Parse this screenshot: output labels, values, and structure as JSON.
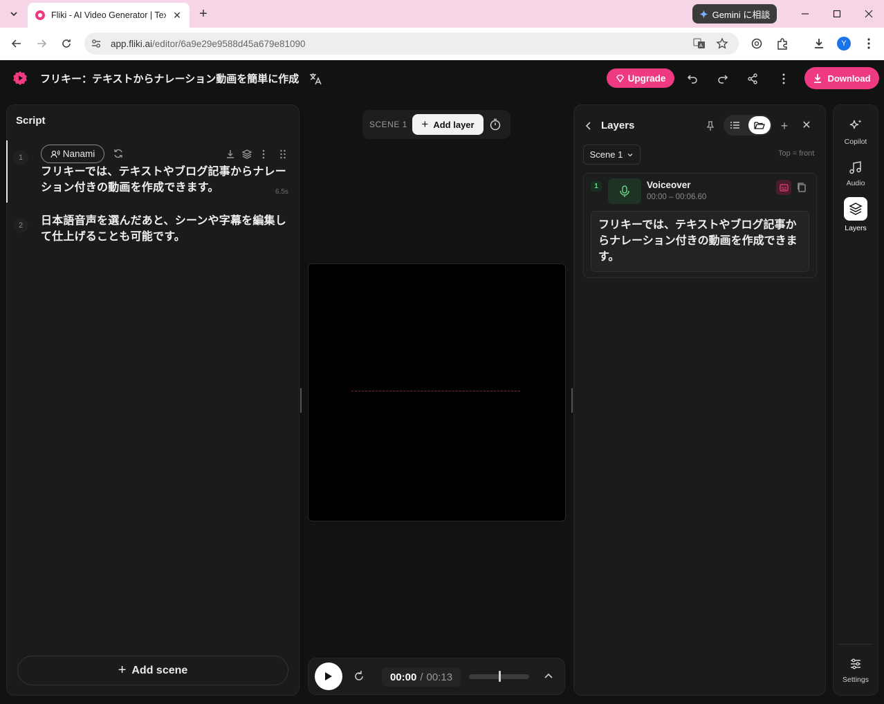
{
  "browser": {
    "tab_title": "Fliki - AI Video Generator | Text",
    "url_host": "app.fliki.ai",
    "url_path": "/editor/6a9e29e9588d45a679e81090",
    "gemini_label": "Gemini に相談",
    "profile_initial": "Y"
  },
  "header": {
    "project_title": "フリキー：テキストからナレーション動画を簡単に作成",
    "upgrade_label": "Upgrade",
    "download_label": "Download",
    "accent": "#ee3a80"
  },
  "script": {
    "title": "Script",
    "voice_name": "Nanami",
    "scenes": [
      {
        "num": "1",
        "text": "フリキーでは、テキストやブログ記事からナレーション付きの動画を作成できます。",
        "duration": "6.5s"
      },
      {
        "num": "2",
        "text": "日本語音声を選んだあと、シーンや字幕を編集して仕上げることも可能です。"
      }
    ],
    "add_scene_label": "Add scene"
  },
  "center": {
    "scene_label": "SCENE 1",
    "add_layer_label": "Add layer",
    "time_current": "00:00",
    "time_separator": "/",
    "time_total": "00:13",
    "volume_level": 0.5
  },
  "layers": {
    "title": "Layers",
    "scene_select": "Scene 1",
    "order_hint": "Top = front",
    "items": [
      {
        "num": "1",
        "name": "Voiceover",
        "time": "00:00 – 00:06.60",
        "text": "フリキーでは、テキストやブログ記事からナレーション付きの動画を作成できます。"
      }
    ]
  },
  "rail": {
    "items": [
      {
        "label": "Copilot",
        "icon": "sparkle-icon"
      },
      {
        "label": "Audio",
        "icon": "music-note-icon"
      },
      {
        "label": "Layers",
        "icon": "layers-icon",
        "active": true
      },
      {
        "label": "Settings",
        "icon": "sliders-icon"
      }
    ]
  }
}
